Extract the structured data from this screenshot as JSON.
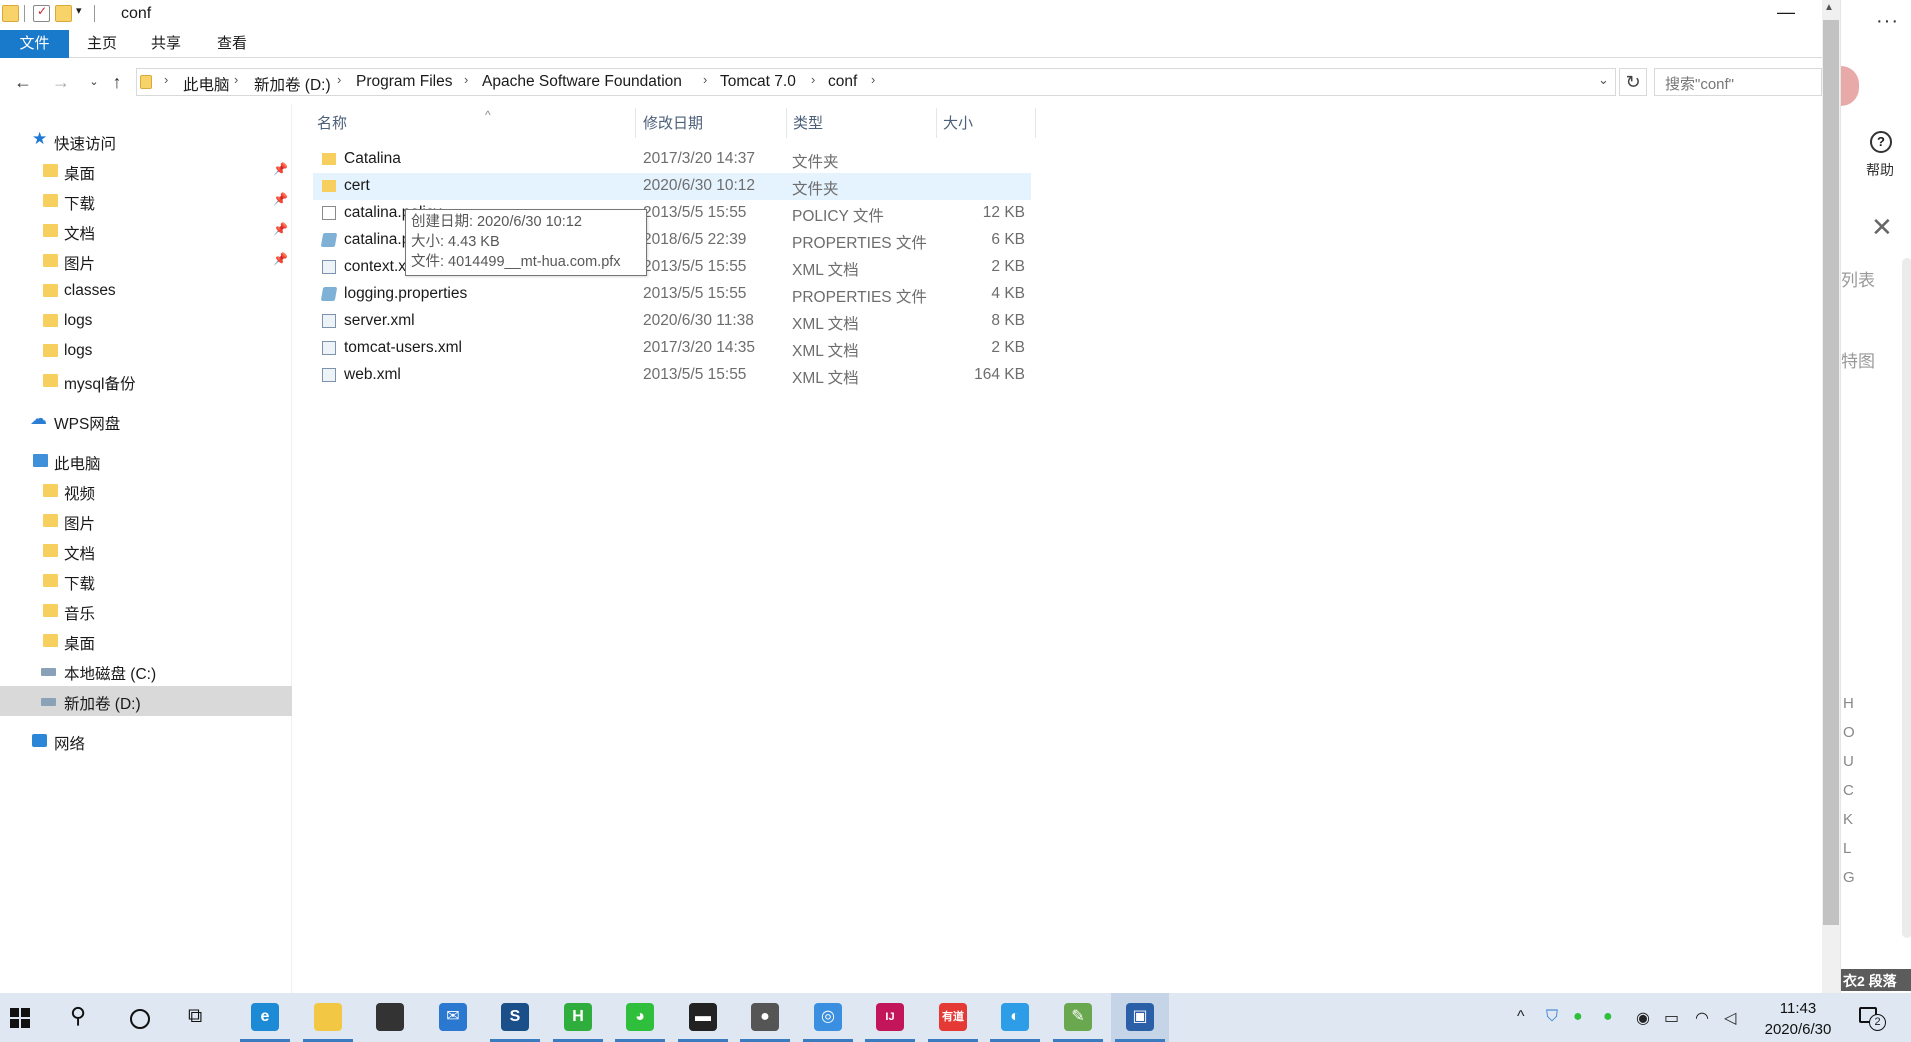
{
  "window": {
    "title": "conf",
    "minimize": "—"
  },
  "ribbon": {
    "tabs": [
      "文件",
      "主页",
      "共享",
      "查看"
    ]
  },
  "address": {
    "crumbs": [
      "此电脑",
      "新加卷 (D:)",
      "Program Files",
      "Apache Software Foundation",
      "Tomcat 7.0",
      "conf"
    ],
    "search_placeholder": "搜索\"conf\""
  },
  "nav": {
    "items": [
      {
        "label": "快速访问",
        "icon": "star-icon",
        "pinned": false
      },
      {
        "label": "桌面",
        "icon": "desktop-folder-icon",
        "pinned": true
      },
      {
        "label": "下载",
        "icon": "downloads-folder-icon",
        "pinned": true
      },
      {
        "label": "文档",
        "icon": "documents-folder-icon",
        "pinned": true
      },
      {
        "label": "图片",
        "icon": "pictures-folder-icon",
        "pinned": true
      },
      {
        "label": "classes",
        "icon": "folder-icon",
        "pinned": false
      },
      {
        "label": "logs",
        "icon": "folder-icon",
        "pinned": false
      },
      {
        "label": "logs",
        "icon": "folder-icon",
        "pinned": false
      },
      {
        "label": "mysql备份",
        "icon": "folder-icon",
        "pinned": false
      },
      {
        "label": "WPS网盘",
        "icon": "cloud-icon",
        "pinned": false
      },
      {
        "label": "此电脑",
        "icon": "pc-icon",
        "pinned": false
      },
      {
        "label": "视频",
        "icon": "videos-folder-icon",
        "pinned": false
      },
      {
        "label": "图片",
        "icon": "pictures-folder-icon",
        "pinned": false
      },
      {
        "label": "文档",
        "icon": "documents-folder-icon",
        "pinned": false
      },
      {
        "label": "下载",
        "icon": "downloads-folder-icon",
        "pinned": false
      },
      {
        "label": "音乐",
        "icon": "music-folder-icon",
        "pinned": false
      },
      {
        "label": "桌面",
        "icon": "desktop-folder-icon",
        "pinned": false
      },
      {
        "label": "本地磁盘 (C:)",
        "icon": "drive-icon",
        "pinned": false
      },
      {
        "label": "新加卷 (D:)",
        "icon": "drive-icon",
        "pinned": false,
        "selected": true
      },
      {
        "label": "网络",
        "icon": "network-icon",
        "pinned": false
      }
    ]
  },
  "columns": {
    "name": "名称",
    "modified": "修改日期",
    "type": "类型",
    "size": "大小"
  },
  "files": [
    {
      "name": "Catalina",
      "modified": "2017/3/20 14:37",
      "type": "文件夹",
      "size": "",
      "icon": "folder-icon"
    },
    {
      "name": "cert",
      "modified": "2020/6/30 10:12",
      "type": "文件夹",
      "size": "",
      "icon": "folder-icon",
      "hover": true
    },
    {
      "name": "catalina.policy",
      "modified": "2013/5/5 15:55",
      "type": "POLICY 文件",
      "size": "12 KB",
      "icon": "file-icon"
    },
    {
      "name": "catalina.properties",
      "modified": "2018/6/5 22:39",
      "type": "PROPERTIES 文件",
      "size": "6 KB",
      "icon": "properties-file-icon"
    },
    {
      "name": "context.xml",
      "modified": "2013/5/5 15:55",
      "type": "XML 文档",
      "size": "2 KB",
      "icon": "xml-file-icon"
    },
    {
      "name": "logging.properties",
      "modified": "2013/5/5 15:55",
      "type": "PROPERTIES 文件",
      "size": "4 KB",
      "icon": "properties-file-icon"
    },
    {
      "name": "server.xml",
      "modified": "2020/6/30 11:38",
      "type": "XML 文档",
      "size": "8 KB",
      "icon": "xml-file-icon"
    },
    {
      "name": "tomcat-users.xml",
      "modified": "2017/3/20 14:35",
      "type": "XML 文档",
      "size": "2 KB",
      "icon": "xml-file-icon"
    },
    {
      "name": "web.xml",
      "modified": "2013/5/5 15:55",
      "type": "XML 文档",
      "size": "164 KB",
      "icon": "xml-file-icon"
    }
  ],
  "tooltip": {
    "created": "创建日期: 2020/6/30 10:12",
    "size": "大小: 4.43 KB",
    "file": "文件: 4014499__mt-hua.com.pfx"
  },
  "right_panel": {
    "more": "···",
    "help": "帮助",
    "text1": "列表",
    "text2": "特图",
    "letters": [
      "H",
      "O",
      "U",
      "C",
      "K",
      "L",
      "G"
    ],
    "badge": "2 段落",
    "badge_prefix": "衣"
  },
  "taskbar": {
    "apps": [
      {
        "name": "edge-app",
        "glyph": "e",
        "color": "#1d8ad6"
      },
      {
        "name": "file-explorer-app",
        "glyph": "",
        "color": "#f2c744"
      },
      {
        "name": "store-app",
        "glyph": "",
        "color": "#333333"
      },
      {
        "name": "mail-app",
        "glyph": "✉",
        "color": "#2a78cf"
      },
      {
        "name": "sublime-app",
        "glyph": "S",
        "color": "#1b4f8a"
      },
      {
        "name": "hbuilder-app",
        "glyph": "H",
        "color": "#2fae3e"
      },
      {
        "name": "wechat-app",
        "glyph": "◕",
        "color": "#2fbf3c"
      },
      {
        "name": "terminal-app",
        "glyph": "▬",
        "color": "#222222"
      },
      {
        "name": "recorder-app",
        "glyph": "●",
        "color": "#555555"
      },
      {
        "name": "browser-app",
        "glyph": "◎",
        "color": "#3a8fe0"
      },
      {
        "name": "intellij-app",
        "glyph": "IJ",
        "color": "#c3155a"
      },
      {
        "name": "youdao-app",
        "glyph": "有道",
        "color": "#e53935"
      },
      {
        "name": "qq-browser-app",
        "glyph": "◐",
        "color": "#2d9de8"
      },
      {
        "name": "notepad-app",
        "glyph": "✎",
        "color": "#6aa84f"
      },
      {
        "name": "remote-desktop-app",
        "glyph": "▣",
        "color": "#2b5fa8"
      }
    ],
    "time": "11:43",
    "date": "2020/6/30",
    "notifications": "2"
  }
}
